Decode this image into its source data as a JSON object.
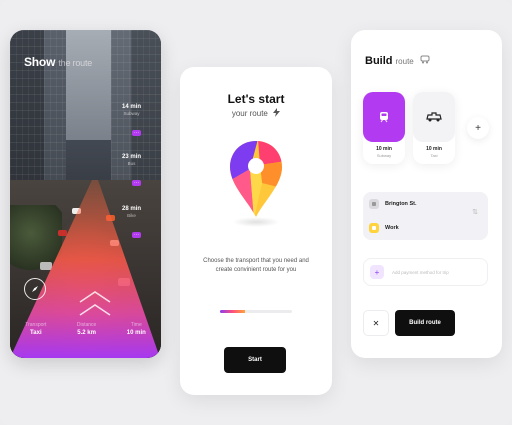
{
  "screen1": {
    "title_bold": "Show",
    "title_light": "the route",
    "stops": [
      {
        "time": "14 min",
        "label": "Subway"
      },
      {
        "time": "23 min",
        "label": "Bus"
      },
      {
        "time": "28 min",
        "label": "Bike"
      }
    ],
    "stop_badge": "···",
    "stats": [
      {
        "label": "Transport",
        "value": "Taxi"
      },
      {
        "label": "Distance",
        "value": "5.2 km"
      },
      {
        "label": "Time",
        "value": "10 min"
      }
    ],
    "icons": {
      "compass": "compass-icon",
      "chevrons": "chevron-up-icon"
    }
  },
  "screen2": {
    "title": "Let's start",
    "subtitle": "your route",
    "description": "Choose the transport that you need and create convinient route for you",
    "progress": 0.35,
    "start_label": "Start",
    "icons": {
      "bolt": "bolt-icon",
      "pin": "map-pin-icon"
    }
  },
  "screen3": {
    "title_bold": "Build",
    "title_light": "route",
    "modes": [
      {
        "time": "10 min",
        "name": "Subway",
        "icon": "subway-icon",
        "active": true
      },
      {
        "time": "10 min",
        "name": "Taxi",
        "icon": "taxi-icon",
        "active": false
      }
    ],
    "from": "Brington St.",
    "to": "Work",
    "payment_placeholder": "Add payment method for trip",
    "close_label": "✕",
    "build_label": "Build route",
    "add_label": "+"
  },
  "colors": {
    "accent_purple": "#b23af0",
    "pin_purple": "#7d3cf0",
    "pin_pink": "#ff3f6f",
    "pin_yellow": "#ffc83a",
    "pin_orange": "#ff8f2a",
    "dark_button": "#0f0f10",
    "route_yellow": "#ffd33d"
  }
}
